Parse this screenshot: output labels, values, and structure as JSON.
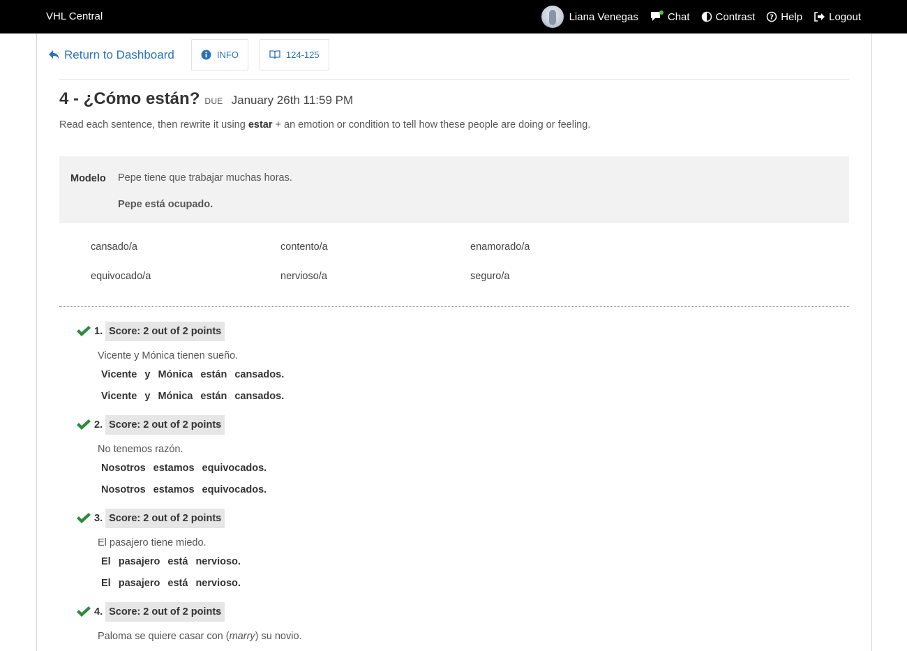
{
  "header": {
    "brand": "VHL Central",
    "user_name": "Liana Venegas",
    "nav": [
      {
        "label": "Chat",
        "icon": "chat-icon"
      },
      {
        "label": "Contrast",
        "icon": "contrast-icon"
      },
      {
        "label": "Help",
        "icon": "help-icon"
      },
      {
        "label": "Logout",
        "icon": "logout-icon"
      }
    ]
  },
  "toolbar": {
    "return_label": "Return to Dashboard",
    "info_label": "INFO",
    "pages_label": "124-125"
  },
  "activity": {
    "title": "4 - ¿Cómo están?",
    "due_label": "DUE",
    "due_date": "January 26th 11:59 PM",
    "instructions_pre": "Read each sentence, then rewrite it using ",
    "instructions_bold": "estar",
    "instructions_post": " + an emotion or condition to tell how these people are doing or feeling."
  },
  "model": {
    "label": "Modelo",
    "question": "Pepe tiene que trabajar muchas horas.",
    "answer": "Pepe está ocupado."
  },
  "word_bank": [
    "cansado/a",
    "contento/a",
    "enamorado/a",
    "equivocado/a",
    "nervioso/a",
    "seguro/a"
  ],
  "items": [
    {
      "number": "1.",
      "score": "Score: 2 out of 2 points",
      "prompt": "Vicente y Mónica tienen sueño.",
      "answer": "Vicente y Mónica están cansados.",
      "correct": "Vicente y Mónica están cansados."
    },
    {
      "number": "2.",
      "score": "Score: 2 out of 2 points",
      "prompt": "No tenemos razón.",
      "answer": "Nosotros estamos equivocados.",
      "correct": "Nosotros estamos equivocados."
    },
    {
      "number": "3.",
      "score": "Score: 2 out of 2 points",
      "prompt": "El pasajero tiene miedo.",
      "answer": "El pasajero está nervioso.",
      "correct": "El pasajero está nervioso."
    },
    {
      "number": "4.",
      "score": "Score: 2 out of 2 points",
      "prompt_pre": "Paloma se quiere casar con (",
      "prompt_em": "marry",
      "prompt_post": ") su novio."
    }
  ],
  "colors": {
    "accent": "#2a73b8",
    "check": "#2e8b3e",
    "topbar": "#000000"
  }
}
